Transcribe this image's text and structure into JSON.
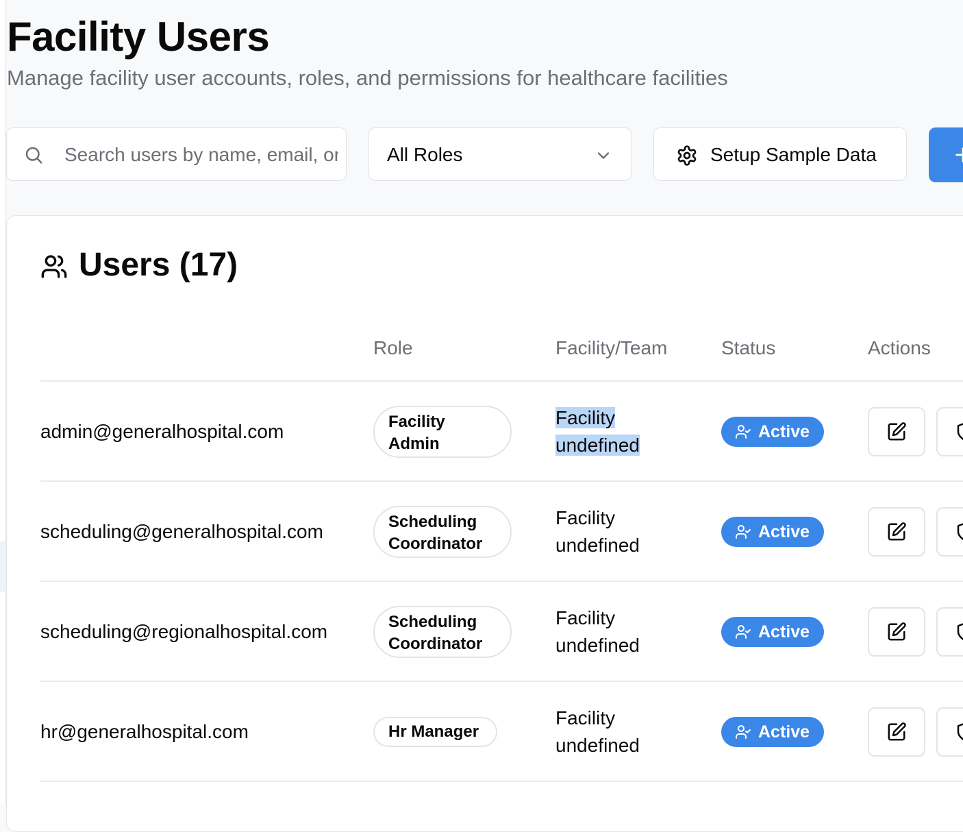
{
  "page": {
    "title": "Facility Users",
    "subtitle": "Manage facility user accounts, roles, and permissions for healthcare facilities"
  },
  "toolbar": {
    "search_placeholder": "Search users by name, email, or role...",
    "role_filter_value": "All Roles",
    "setup_label": "Setup Sample Data",
    "add_button_icon": "plus-icon"
  },
  "users_card": {
    "title": "Users (17)",
    "columns": [
      "Role",
      "Facility/Team",
      "Status",
      "Actions"
    ],
    "rows": [
      {
        "email": "admin@generalhospital.com",
        "role_line1": "Facility",
        "role_line2": "Admin",
        "facility_line1": "Facility",
        "facility_line2": "undefined",
        "status": "Active"
      },
      {
        "email": "scheduling@generalhospital.com",
        "role_line1": "Scheduling",
        "role_line2": "Coordinator",
        "facility_line1": "Facility",
        "facility_line2": "undefined",
        "status": "Active"
      },
      {
        "email": "scheduling@regionalhospital.com",
        "role_line1": "Scheduling",
        "role_line2": "Coordinator",
        "facility_line1": "Facility",
        "facility_line2": "undefined",
        "status": "Active"
      },
      {
        "email": "hr@generalhospital.com",
        "role_line1": "Hr Manager",
        "role_line2": "",
        "facility_line1": "Facility",
        "facility_line2": "undefined",
        "status": "Active"
      }
    ]
  },
  "colors": {
    "accent": "#3b87e8",
    "selection": "#bad6f7",
    "muted_text": "#6b7076",
    "border": "#e1e4e8"
  }
}
